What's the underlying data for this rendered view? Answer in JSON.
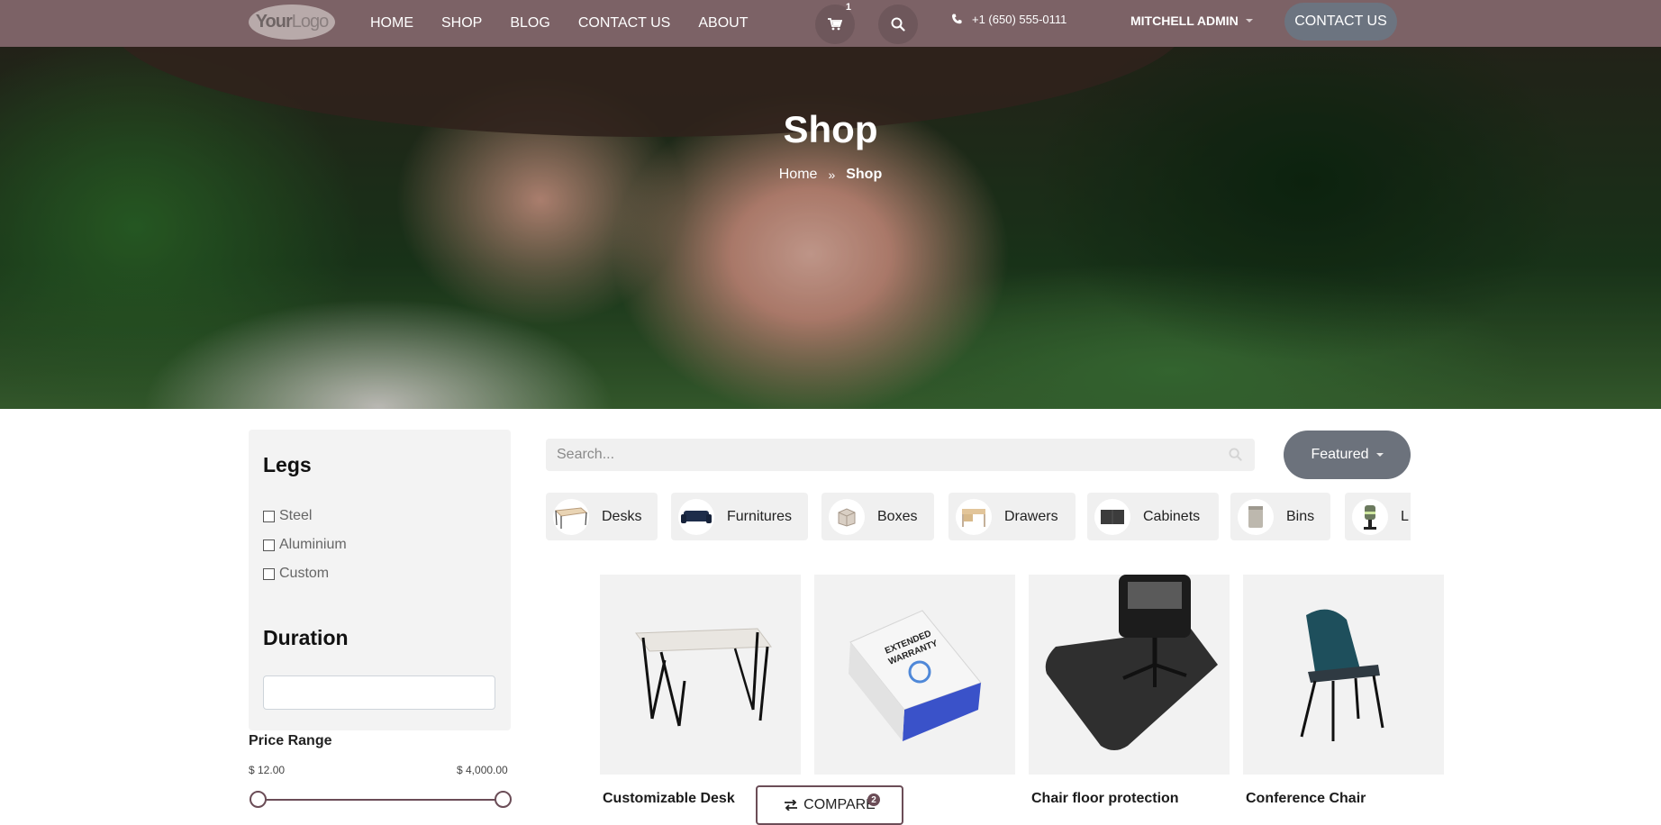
{
  "header": {
    "logo_strong": "Your",
    "logo_rest": "Logo",
    "nav": [
      "HOME",
      "SHOP",
      "BLOG",
      "CONTACT US",
      "ABOUT"
    ],
    "cart_count": "1",
    "phone": "+1 (650) 555-0111",
    "user": "MITCHELL ADMIN",
    "contact_button": "CONTACT US",
    "bg_color": "#7c6266"
  },
  "hero": {
    "title": "Shop",
    "breadcrumb_home": "Home",
    "breadcrumb_current": "Shop"
  },
  "sidebar": {
    "legs_title": "Legs",
    "legs_options": [
      "Steel",
      "Aluminium",
      "Custom"
    ],
    "duration_title": "Duration",
    "duration_value": "",
    "price_title": "Price Range",
    "price_min": "$ 12.00",
    "price_max": "$ 4,000.00",
    "price_range_fraction": [
      0,
      1
    ]
  },
  "toolbar": {
    "search_placeholder": "Search...",
    "sort_label": "Featured"
  },
  "categories": [
    "Desks",
    "Furnitures",
    "Boxes",
    "Drawers",
    "Cabinets",
    "Bins",
    "L"
  ],
  "products": [
    "Customizable Desk",
    "",
    "Chair floor protection",
    "Conference Chair"
  ],
  "compare": {
    "label": "COMPARE",
    "count": "2"
  },
  "colors": {
    "accent": "#6b4d57",
    "button_gray": "#6c727c"
  }
}
